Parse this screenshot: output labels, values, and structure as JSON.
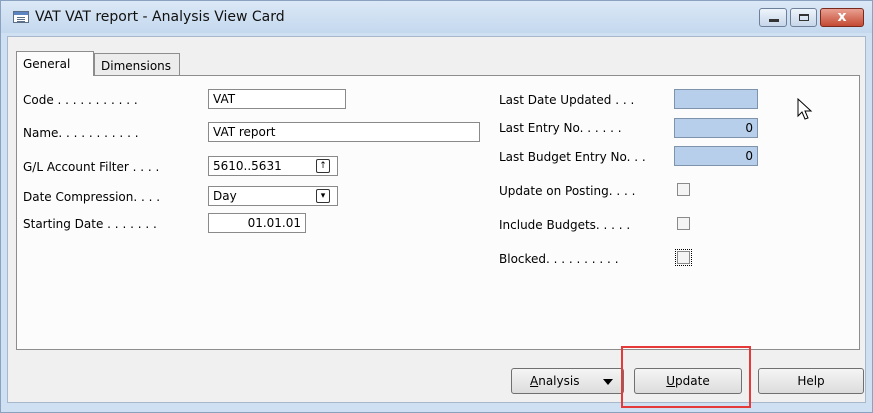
{
  "window": {
    "title": "VAT VAT report - Analysis View Card",
    "close_glyph": "x"
  },
  "tabs": [
    {
      "label": "General"
    },
    {
      "label": "Dimensions"
    }
  ],
  "left_fields": {
    "code": {
      "label": "Code . . . . . . . . . . .",
      "value": "VAT"
    },
    "name": {
      "label": "Name. . . . . . . . . . .",
      "value": "VAT report"
    },
    "gl_filter": {
      "label": "G/L Account Filter . . . .",
      "value": "5610..5631",
      "button_icon": "lookup-arrow-icon",
      "button_glyph": "↑"
    },
    "date_compression": {
      "label": "Date Compression. . . .",
      "value": "Day",
      "button_icon": "dropdown-arrow-icon",
      "button_glyph": "▾"
    },
    "starting_date": {
      "label": "Starting Date . . . . . . .",
      "value": "01.01.01"
    }
  },
  "right_fields": {
    "last_date_updated": {
      "label": "Last Date Updated . . .",
      "value": ""
    },
    "last_entry_no": {
      "label": "Last Entry No. . . . . .",
      "value": "0"
    },
    "last_budget_entry_no": {
      "label": "Last Budget Entry No. . .",
      "value": "0"
    },
    "update_on_posting": {
      "label": "Update on Posting. . . .",
      "checked": false
    },
    "include_budgets": {
      "label": "Include Budgets. . . . .",
      "checked": false
    },
    "blocked": {
      "label": "Blocked. . . . . . . . . .",
      "checked": false
    }
  },
  "buttons": {
    "analysis": {
      "label_first": "A",
      "label_rest": "nalysis"
    },
    "update": {
      "label_first": "U",
      "label_rest": "pdate"
    },
    "help": {
      "label": "Help"
    }
  },
  "colors": {
    "highlight": "#e43a3a",
    "readonly_field": "#b8cfeb"
  }
}
